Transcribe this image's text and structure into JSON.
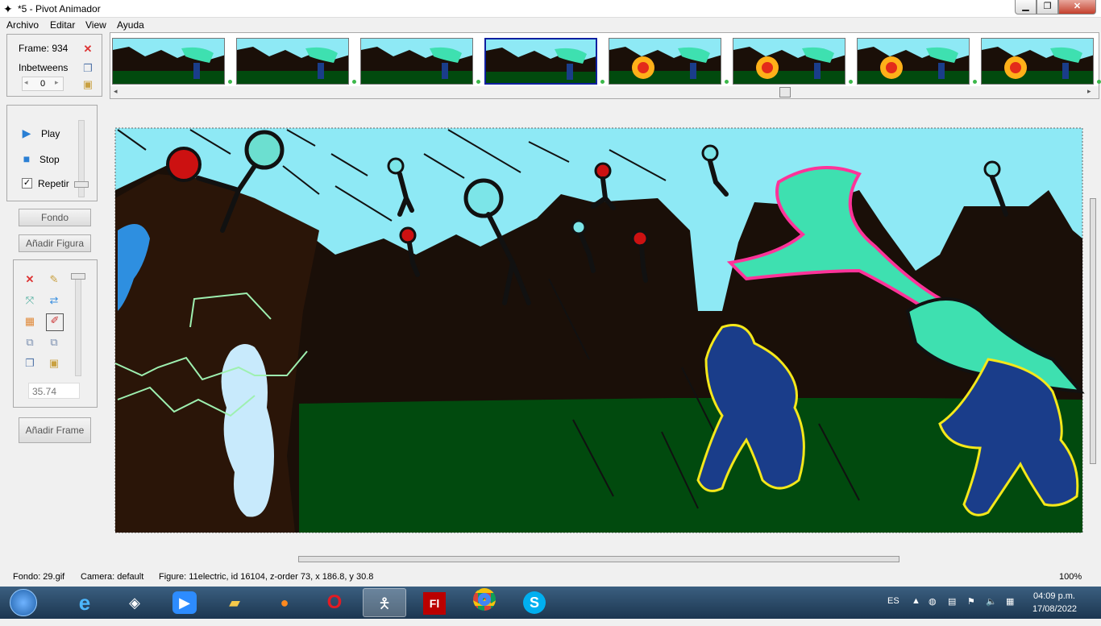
{
  "window": {
    "title": "*5 - Pivot Animador"
  },
  "menu": [
    "Archivo",
    "Editar",
    "View",
    "Ayuda"
  ],
  "frame_panel": {
    "frame_label": "Frame: 934",
    "inbetweens_label": "Inbetweens",
    "inbetweens_value": "0"
  },
  "playback": {
    "play_label": "Play",
    "stop_label": "Stop",
    "repeat_label": "Repetir",
    "repeat_checked": true
  },
  "buttons": {
    "background": "Fondo",
    "add_figure": "Añadir Figura",
    "add_frame": "Añadir Frame"
  },
  "figure_tools": {
    "scale_value": "35.74",
    "icons": [
      "delete-icon",
      "pencil-icon",
      "resize-icon",
      "flip-icon",
      "color-icon",
      "brush-icon",
      "bring-front-icon",
      "send-back-icon",
      "copy-icon",
      "paste-icon"
    ]
  },
  "timeline": {
    "selected_index": 3,
    "frame_count_visible": 8
  },
  "status": {
    "background": "Fondo: 29.gif",
    "camera": "Camera: default",
    "figure": "Figure: 11electric,  id 16104,  z-order 73,  x 186.8, y 30.8",
    "zoom": "100%"
  },
  "taskbar": {
    "lang": "ES",
    "time": "04:09 p.m.",
    "date": "17/08/2022",
    "apps": [
      "ie-icon",
      "game-icon",
      "zoom-icon",
      "explorer-icon",
      "firefox-icon",
      "opera-icon",
      "pivot-icon",
      "flash-icon",
      "chrome-icon",
      "skype-icon"
    ]
  },
  "colors": {
    "sky": "#8ee9f5",
    "mountain": "#1a0f08",
    "ground": "#014a0e",
    "selection": "#1020a0"
  }
}
